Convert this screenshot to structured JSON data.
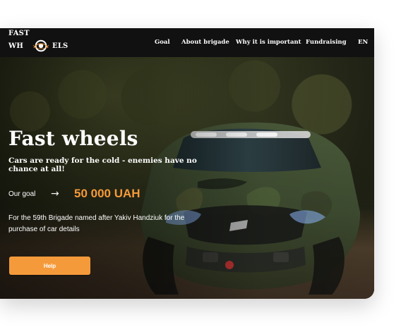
{
  "nav": {
    "logo_text": {
      "line1": "FAST",
      "line2_left": "WH",
      "line2_right": "ELS"
    },
    "items": [
      {
        "label": "Goal"
      },
      {
        "label": "About brigade"
      },
      {
        "label": "Why it is important"
      },
      {
        "label": "Fundraising"
      },
      {
        "label": "EN"
      }
    ]
  },
  "hero": {
    "title": "Fast wheels",
    "subtitle": "Cars are ready for the cold - enemies have no chance at all!",
    "goal_label": "Our goal",
    "goal_arrow": "→",
    "goal_amount": "50 000 UAH",
    "description": "For the 59th Brigade named after Yakiv Handziuk for the purchase of car details",
    "help_button": "Help"
  },
  "colors": {
    "accent": "#f59a3a",
    "nav_bg": "#111111",
    "text": "#ffffff"
  },
  "icons": {
    "logo_wheel": "wheel-icon",
    "goal_arrow": "arrow-right-icon"
  }
}
